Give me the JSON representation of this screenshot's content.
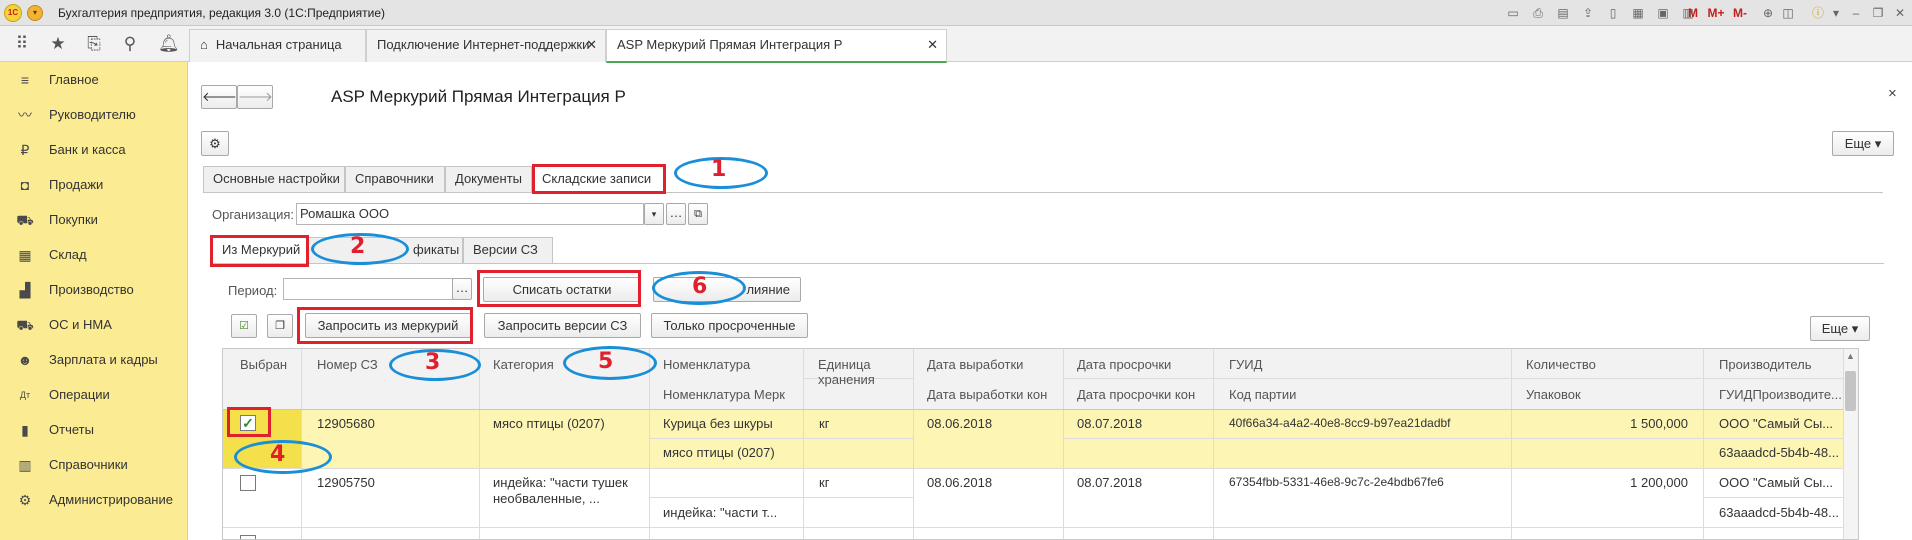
{
  "window": {
    "title": "Бухгалтерия предприятия, редакция 3.0  (1С:Предприятие)"
  },
  "titlebar_icons": [
    "save-icon",
    "print-icon",
    "preview-icon",
    "upload-icon",
    "doc-icon",
    "table-icon",
    "calendar-icon",
    "calc-icon"
  ],
  "titlebar_m": {
    "m": "M",
    "mplus": "M+",
    "mminus": "M-"
  },
  "open_tabs": [
    {
      "label": "Начальная страница"
    },
    {
      "label": "Подключение Интернет-поддержки"
    },
    {
      "label": "ASP Меркурий Прямая Интеграция Р"
    }
  ],
  "sidebar": {
    "items": [
      {
        "label": "Главное",
        "icon": "hamburger-icon"
      },
      {
        "label": "Руководителю",
        "icon": "chart-line-icon"
      },
      {
        "label": "Банк и касса",
        "icon": "ruble-icon"
      },
      {
        "label": "Продажи",
        "icon": "bag-icon"
      },
      {
        "label": "Покупки",
        "icon": "cart-icon"
      },
      {
        "label": "Склад",
        "icon": "warehouse-icon"
      },
      {
        "label": "Производство",
        "icon": "factory-icon"
      },
      {
        "label": "ОС и НМА",
        "icon": "truck-icon"
      },
      {
        "label": "Зарплата и кадры",
        "icon": "person-icon"
      },
      {
        "label": "Операции",
        "icon": "dtkt-icon"
      },
      {
        "label": "Отчеты",
        "icon": "bars-icon"
      },
      {
        "label": "Справочники",
        "icon": "book-icon"
      },
      {
        "label": "Администрирование",
        "icon": "gear-icon"
      }
    ]
  },
  "form": {
    "title": "ASP Меркурий Прямая Интеграция Р",
    "more_label": "Еще",
    "close_glyph": "×",
    "tabs": [
      {
        "label": "Основные настройки"
      },
      {
        "label": "Справочники"
      },
      {
        "label": "Документы"
      },
      {
        "label": "Складские записи"
      }
    ],
    "org_label": "Организация:",
    "org_value": "Ромашка ООО",
    "subtabs": [
      {
        "label": "Из Меркурий"
      },
      {
        "label": "фикаты"
      },
      {
        "label": "Версии СЗ"
      }
    ],
    "period_label": "Период:",
    "period_value": "",
    "buttons": {
      "write_off": "Списать остатки",
      "merge": "лияние",
      "request_merkury": "Запросить из меркурий",
      "request_versions": "Запросить версии СЗ",
      "only_expired": "Только просроченные",
      "more": "Еще"
    }
  },
  "table": {
    "headers": {
      "selected": "Выбран",
      "sz_number": "Номер СЗ",
      "category": "Категория",
      "nomenclature": "Номенклатура",
      "nomenclature_merk": "Номенклатура Мерк",
      "unit": "Единица хранения",
      "prod_date": "Дата выработки",
      "prod_date_end": "Дата выработки кон",
      "exp_date": "Дата просрочки",
      "exp_date_end": "Дата просрочки кон",
      "guid": "ГУИД",
      "batch_code": "Код партии",
      "quantity": "Количество",
      "packaging": "Упаковок",
      "producer": "Производитель",
      "producer_guid": "ГУИДПроизводите..."
    },
    "rows": [
      {
        "selected": true,
        "sz_number": "12905680",
        "category": "мясо птицы (0207)",
        "nomenclature": "Курица без шкуры",
        "nomenclature_merk": "мясо птицы (0207)",
        "unit": "кг",
        "prod_date": "08.06.2018",
        "exp_date": "08.07.2018",
        "guid": "40f66a34-a4a2-40e8-8cc9-b97ea21dadbf",
        "quantity": "1 500,000",
        "producer": "ООО \"Самый  Сы...",
        "producer_guid": "63aaadcd-5b4b-48..."
      },
      {
        "selected": false,
        "sz_number": "12905750",
        "category": "индейка: \"части тушек необваленные, ...",
        "nomenclature": "",
        "nomenclature_merk": "индейка: \"части т...",
        "unit": "кг",
        "prod_date": "08.06.2018",
        "exp_date": "08.07.2018",
        "guid": "67354fbb-5331-46e8-9c7c-2e4bdb67fe6",
        "quantity": "1 200,000",
        "producer": "ООО \"Самый  Сы...",
        "producer_guid": "63aaadcd-5b4b-48..."
      }
    ]
  },
  "annotations": [
    "1",
    "2",
    "3",
    "4",
    "5",
    "6"
  ],
  "colors": {
    "sidebar_bg": "#fbeb93",
    "selected_row": "#fdf5b4",
    "active_tab_line": "#4aa651",
    "annotation_red": "#e0202c",
    "annotation_blue": "#1a8fd8"
  }
}
